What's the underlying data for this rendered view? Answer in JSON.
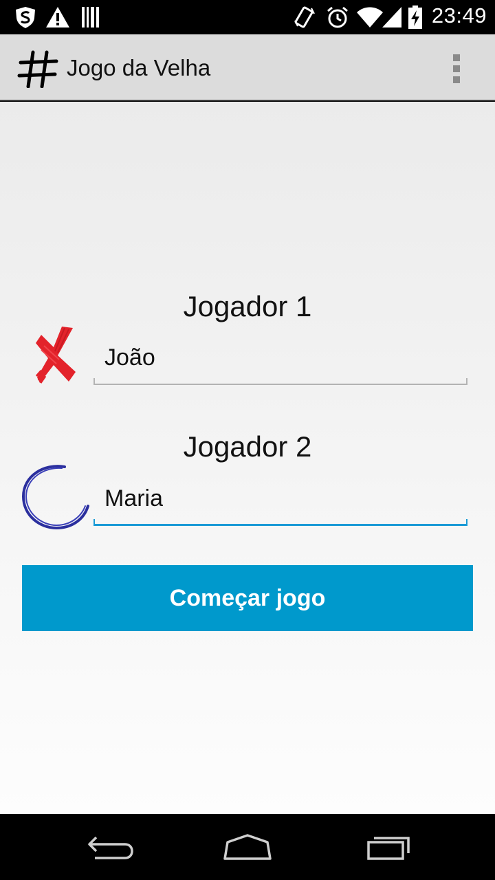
{
  "status_bar": {
    "time": "23:49",
    "icons": [
      "shield-icon",
      "warning-icon",
      "barcode-icon",
      "rotate-icon",
      "alarm-icon",
      "wifi-icon",
      "signal-icon",
      "battery-charging-icon"
    ]
  },
  "action_bar": {
    "title": "Jogo da Velha",
    "icon": "hash-icon",
    "overflow_icon": "overflow-menu-icon"
  },
  "players": {
    "player1": {
      "label": "Jogador 1",
      "name": "João",
      "symbol_icon": "x-icon"
    },
    "player2": {
      "label": "Jogador 2",
      "name": "Maria",
      "symbol_icon": "o-icon"
    }
  },
  "start_button": {
    "label": "Começar jogo"
  },
  "nav_bar": {
    "icons": [
      "back-icon",
      "home-icon",
      "recents-icon"
    ]
  },
  "colors": {
    "accent": "#0099cc",
    "action_bar": "#dcdcdc",
    "x_symbol": "#e3232b",
    "o_symbol": "#2b2f9e",
    "focused_underline": "#1a9ad6"
  }
}
